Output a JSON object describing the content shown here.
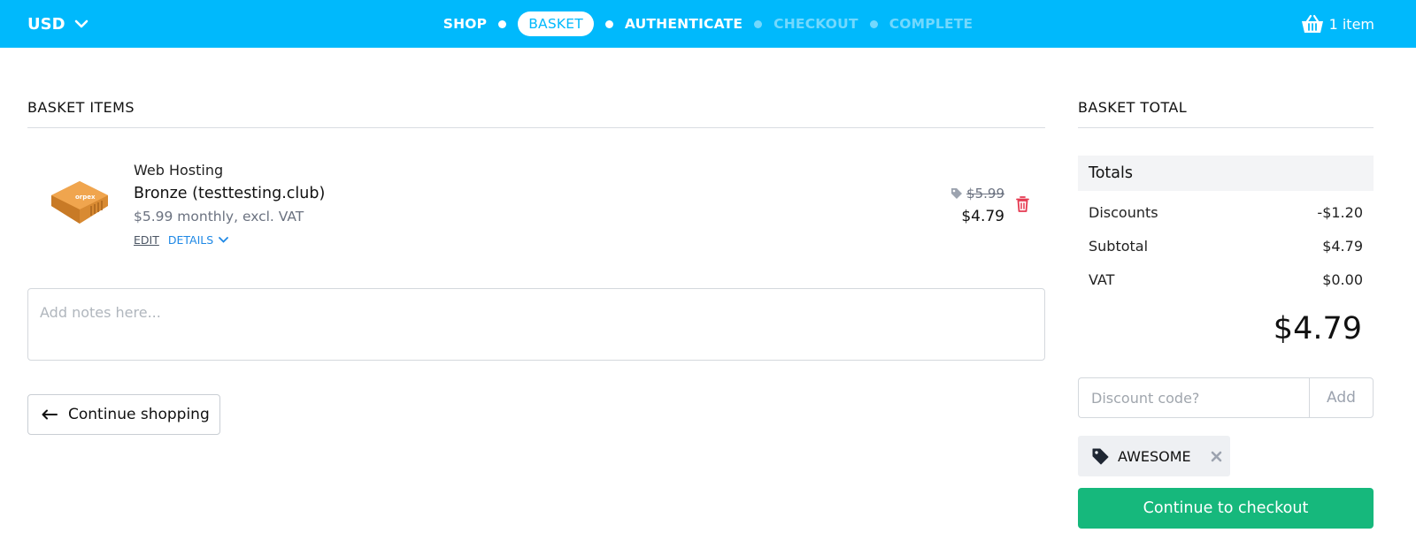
{
  "header": {
    "currency": "USD",
    "steps": [
      {
        "label": "SHOP",
        "state": "done"
      },
      {
        "label": "BASKET",
        "state": "active"
      },
      {
        "label": "AUTHENTICATE",
        "state": "done"
      },
      {
        "label": "CHECKOUT",
        "state": "disabled"
      },
      {
        "label": "COMPLETE",
        "state": "disabled"
      }
    ],
    "cart_label": "1 item"
  },
  "basket": {
    "title": "BASKET ITEMS",
    "item": {
      "category": "Web Hosting",
      "name": "Bronze (testtesting.club)",
      "price_desc": "$5.99 monthly, excl. VAT",
      "edit_label": "EDIT",
      "details_label": "DETAILS",
      "old_price": "$5.99",
      "new_price": "$4.79",
      "image_text": "orpex"
    },
    "notes_placeholder": "Add notes here...",
    "continue_shopping": "Continue shopping"
  },
  "totals": {
    "title": "BASKET TOTAL",
    "heading": "Totals",
    "rows": [
      {
        "label": "Discounts",
        "value": "-$1.20"
      },
      {
        "label": "Subtotal",
        "value": "$4.79"
      },
      {
        "label": "VAT",
        "value": "$0.00"
      }
    ],
    "grand_total": "$4.79",
    "discount_placeholder": "Discount code?",
    "add_label": "Add",
    "coupon": "AWESOME",
    "checkout_label": "Continue to checkout"
  },
  "colors": {
    "brand": "#00b9fc",
    "checkout": "#16b87c",
    "delete": "#e53950",
    "link": "#1e88e5"
  },
  "icons": [
    "chevron-down-icon",
    "basket-icon",
    "tag-icon",
    "trash-icon",
    "arrow-left-icon",
    "close-icon"
  ]
}
